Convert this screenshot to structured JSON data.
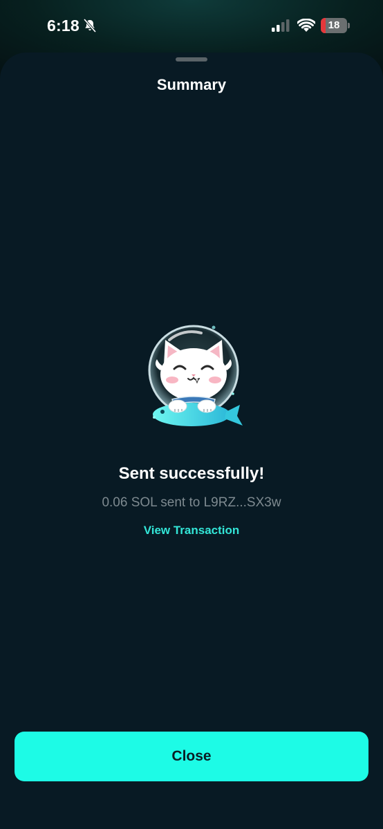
{
  "status_bar": {
    "time": "6:18",
    "icons": [
      "bell-slash-icon",
      "signal-icon",
      "wifi-icon",
      "battery-icon"
    ],
    "battery_level": "18",
    "battery_fraction": 0.18,
    "battery_color": "#e5383b"
  },
  "sheet": {
    "title": "Summary"
  },
  "result": {
    "mascot_icon": "astronaut-cat-illustration",
    "title": "Sent successfully!",
    "detail": "0.06 SOL sent to L9RZ...SX3w",
    "link_label": "View Transaction"
  },
  "footer": {
    "close_label": "Close"
  },
  "colors": {
    "accent": "#1dfbe6",
    "link": "#33e6d8",
    "sheet_background": "#081a24",
    "muted_text": "#7e8a90"
  }
}
